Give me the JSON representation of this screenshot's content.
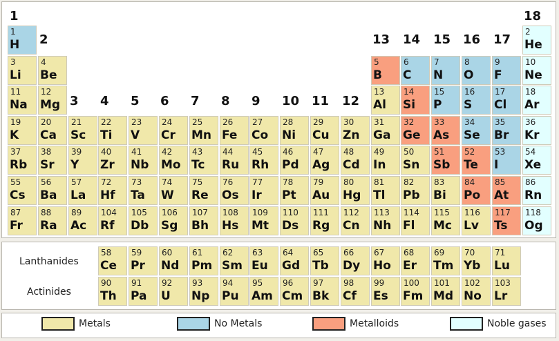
{
  "colors": {
    "metal": "#f0e8aa",
    "nonmetal": "#aad5e6",
    "metalloid": "#f99f7f",
    "noble": "#e2ffff"
  },
  "group_labels": [
    "1",
    "2",
    "3",
    "4",
    "5",
    "6",
    "7",
    "8",
    "9",
    "10",
    "11",
    "12",
    "13",
    "14",
    "15",
    "16",
    "17",
    "18"
  ],
  "row_labels": {
    "lanthanides": "Lanthanides",
    "actinides": "Actinides"
  },
  "legend": [
    {
      "label": "Metals",
      "category": "metal"
    },
    {
      "label": "No Metals",
      "category": "nonmetal"
    },
    {
      "label": "Metalloids",
      "category": "metalloid"
    },
    {
      "label": "Noble gases",
      "category": "noble"
    }
  ],
  "elements": [
    {
      "n": "1",
      "s": "H",
      "period": 1,
      "group": 1,
      "cat": "nonmetal"
    },
    {
      "n": "2",
      "s": "He",
      "period": 1,
      "group": 18,
      "cat": "noble"
    },
    {
      "n": "3",
      "s": "Li",
      "period": 2,
      "group": 1,
      "cat": "metal"
    },
    {
      "n": "4",
      "s": "Be",
      "period": 2,
      "group": 2,
      "cat": "metal"
    },
    {
      "n": "5",
      "s": "B",
      "period": 2,
      "group": 13,
      "cat": "metalloid"
    },
    {
      "n": "6",
      "s": "C",
      "period": 2,
      "group": 14,
      "cat": "nonmetal"
    },
    {
      "n": "7",
      "s": "N",
      "period": 2,
      "group": 15,
      "cat": "nonmetal"
    },
    {
      "n": "8",
      "s": "O",
      "period": 2,
      "group": 16,
      "cat": "nonmetal"
    },
    {
      "n": "9",
      "s": "F",
      "period": 2,
      "group": 17,
      "cat": "nonmetal"
    },
    {
      "n": "10",
      "s": "Ne",
      "period": 2,
      "group": 18,
      "cat": "noble"
    },
    {
      "n": "11",
      "s": "Na",
      "period": 3,
      "group": 1,
      "cat": "metal"
    },
    {
      "n": "12",
      "s": "Mg",
      "period": 3,
      "group": 2,
      "cat": "metal"
    },
    {
      "n": "13",
      "s": "Al",
      "period": 3,
      "group": 13,
      "cat": "metal"
    },
    {
      "n": "14",
      "s": "Si",
      "period": 3,
      "group": 14,
      "cat": "metalloid"
    },
    {
      "n": "15",
      "s": "P",
      "period": 3,
      "group": 15,
      "cat": "nonmetal"
    },
    {
      "n": "16",
      "s": "S",
      "period": 3,
      "group": 16,
      "cat": "nonmetal"
    },
    {
      "n": "17",
      "s": "Cl",
      "period": 3,
      "group": 17,
      "cat": "nonmetal"
    },
    {
      "n": "18",
      "s": "Ar",
      "period": 3,
      "group": 18,
      "cat": "noble"
    },
    {
      "n": "19",
      "s": "K",
      "period": 4,
      "group": 1,
      "cat": "metal"
    },
    {
      "n": "20",
      "s": "Ca",
      "period": 4,
      "group": 2,
      "cat": "metal"
    },
    {
      "n": "21",
      "s": "Sc",
      "period": 4,
      "group": 3,
      "cat": "metal"
    },
    {
      "n": "22",
      "s": "Ti",
      "period": 4,
      "group": 4,
      "cat": "metal"
    },
    {
      "n": "23",
      "s": "V",
      "period": 4,
      "group": 5,
      "cat": "metal"
    },
    {
      "n": "24",
      "s": "Cr",
      "period": 4,
      "group": 6,
      "cat": "metal"
    },
    {
      "n": "25",
      "s": "Mn",
      "period": 4,
      "group": 7,
      "cat": "metal"
    },
    {
      "n": "26",
      "s": "Fe",
      "period": 4,
      "group": 8,
      "cat": "metal"
    },
    {
      "n": "27",
      "s": "Co",
      "period": 4,
      "group": 9,
      "cat": "metal"
    },
    {
      "n": "28",
      "s": "Ni",
      "period": 4,
      "group": 10,
      "cat": "metal"
    },
    {
      "n": "29",
      "s": "Cu",
      "period": 4,
      "group": 11,
      "cat": "metal"
    },
    {
      "n": "30",
      "s": "Zn",
      "period": 4,
      "group": 12,
      "cat": "metal"
    },
    {
      "n": "31",
      "s": "Ga",
      "period": 4,
      "group": 13,
      "cat": "metal"
    },
    {
      "n": "32",
      "s": "Ge",
      "period": 4,
      "group": 14,
      "cat": "metalloid"
    },
    {
      "n": "33",
      "s": "As",
      "period": 4,
      "group": 15,
      "cat": "metalloid"
    },
    {
      "n": "34",
      "s": "Se",
      "period": 4,
      "group": 16,
      "cat": "nonmetal"
    },
    {
      "n": "35",
      "s": "Br",
      "period": 4,
      "group": 17,
      "cat": "nonmetal"
    },
    {
      "n": "36",
      "s": "Kr",
      "period": 4,
      "group": 18,
      "cat": "noble"
    },
    {
      "n": "37",
      "s": "Rb",
      "period": 5,
      "group": 1,
      "cat": "metal"
    },
    {
      "n": "38",
      "s": "Sr",
      "period": 5,
      "group": 2,
      "cat": "metal"
    },
    {
      "n": "39",
      "s": "Y",
      "period": 5,
      "group": 3,
      "cat": "metal"
    },
    {
      "n": "40",
      "s": "Zr",
      "period": 5,
      "group": 4,
      "cat": "metal"
    },
    {
      "n": "41",
      "s": "Nb",
      "period": 5,
      "group": 5,
      "cat": "metal"
    },
    {
      "n": "42",
      "s": "Mo",
      "period": 5,
      "group": 6,
      "cat": "metal"
    },
    {
      "n": "43",
      "s": "Tc",
      "period": 5,
      "group": 7,
      "cat": "metal"
    },
    {
      "n": "44",
      "s": "Ru",
      "period": 5,
      "group": 8,
      "cat": "metal"
    },
    {
      "n": "45",
      "s": "Rh",
      "period": 5,
      "group": 9,
      "cat": "metal"
    },
    {
      "n": "46",
      "s": "Pd",
      "period": 5,
      "group": 10,
      "cat": "metal"
    },
    {
      "n": "47",
      "s": "Ag",
      "period": 5,
      "group": 11,
      "cat": "metal"
    },
    {
      "n": "48",
      "s": "Cd",
      "period": 5,
      "group": 12,
      "cat": "metal"
    },
    {
      "n": "49",
      "s": "In",
      "period": 5,
      "group": 13,
      "cat": "metal"
    },
    {
      "n": "50",
      "s": "Sn",
      "period": 5,
      "group": 14,
      "cat": "metal"
    },
    {
      "n": "51",
      "s": "Sb",
      "period": 5,
      "group": 15,
      "cat": "metalloid"
    },
    {
      "n": "52",
      "s": "Te",
      "period": 5,
      "group": 16,
      "cat": "metalloid"
    },
    {
      "n": "53",
      "s": "I",
      "period": 5,
      "group": 17,
      "cat": "nonmetal"
    },
    {
      "n": "54",
      "s": "Xe",
      "period": 5,
      "group": 18,
      "cat": "noble"
    },
    {
      "n": "55",
      "s": "Cs",
      "period": 6,
      "group": 1,
      "cat": "metal"
    },
    {
      "n": "56",
      "s": "Ba",
      "period": 6,
      "group": 2,
      "cat": "metal"
    },
    {
      "n": "57",
      "s": "La",
      "period": 6,
      "group": 3,
      "cat": "metal"
    },
    {
      "n": "72",
      "s": "Hf",
      "period": 6,
      "group": 4,
      "cat": "metal"
    },
    {
      "n": "73",
      "s": "Ta",
      "period": 6,
      "group": 5,
      "cat": "metal"
    },
    {
      "n": "74",
      "s": "W",
      "period": 6,
      "group": 6,
      "cat": "metal"
    },
    {
      "n": "75",
      "s": "Re",
      "period": 6,
      "group": 7,
      "cat": "metal"
    },
    {
      "n": "76",
      "s": "Os",
      "period": 6,
      "group": 8,
      "cat": "metal"
    },
    {
      "n": "77",
      "s": "Ir",
      "period": 6,
      "group": 9,
      "cat": "metal"
    },
    {
      "n": "78",
      "s": "Pt",
      "period": 6,
      "group": 10,
      "cat": "metal"
    },
    {
      "n": "79",
      "s": "Au",
      "period": 6,
      "group": 11,
      "cat": "metal"
    },
    {
      "n": "80",
      "s": "Hg",
      "period": 6,
      "group": 12,
      "cat": "metal"
    },
    {
      "n": "81",
      "s": "Tl",
      "period": 6,
      "group": 13,
      "cat": "metal"
    },
    {
      "n": "82",
      "s": "Pb",
      "period": 6,
      "group": 14,
      "cat": "metal"
    },
    {
      "n": "83",
      "s": "Bi",
      "period": 6,
      "group": 15,
      "cat": "metal"
    },
    {
      "n": "84",
      "s": "Po",
      "period": 6,
      "group": 16,
      "cat": "metalloid"
    },
    {
      "n": "85",
      "s": "At",
      "period": 6,
      "group": 17,
      "cat": "metalloid"
    },
    {
      "n": "86",
      "s": "Rn",
      "period": 6,
      "group": 18,
      "cat": "noble"
    },
    {
      "n": "87",
      "s": "Fr",
      "period": 7,
      "group": 1,
      "cat": "metal"
    },
    {
      "n": "88",
      "s": "Ra",
      "period": 7,
      "group": 2,
      "cat": "metal"
    },
    {
      "n": "89",
      "s": "Ac",
      "period": 7,
      "group": 3,
      "cat": "metal"
    },
    {
      "n": "104",
      "s": "Rf",
      "period": 7,
      "group": 4,
      "cat": "metal"
    },
    {
      "n": "105",
      "s": "Db",
      "period": 7,
      "group": 5,
      "cat": "metal"
    },
    {
      "n": "106",
      "s": "Sg",
      "period": 7,
      "group": 6,
      "cat": "metal"
    },
    {
      "n": "107",
      "s": "Bh",
      "period": 7,
      "group": 7,
      "cat": "metal"
    },
    {
      "n": "108",
      "s": "Hs",
      "period": 7,
      "group": 8,
      "cat": "metal"
    },
    {
      "n": "109",
      "s": "Mt",
      "period": 7,
      "group": 9,
      "cat": "metal"
    },
    {
      "n": "110",
      "s": "Ds",
      "period": 7,
      "group": 10,
      "cat": "metal"
    },
    {
      "n": "111",
      "s": "Rg",
      "period": 7,
      "group": 11,
      "cat": "metal"
    },
    {
      "n": "112",
      "s": "Cn",
      "period": 7,
      "group": 12,
      "cat": "metal"
    },
    {
      "n": "113",
      "s": "Nh",
      "period": 7,
      "group": 13,
      "cat": "metal"
    },
    {
      "n": "114",
      "s": "Fl",
      "period": 7,
      "group": 14,
      "cat": "metal"
    },
    {
      "n": "115",
      "s": "Mc",
      "period": 7,
      "group": 15,
      "cat": "metal"
    },
    {
      "n": "116",
      "s": "Lv",
      "period": 7,
      "group": 16,
      "cat": "metal"
    },
    {
      "n": "117",
      "s": "Ts",
      "period": 7,
      "group": 17,
      "cat": "metalloid"
    },
    {
      "n": "118",
      "s": "Og",
      "period": 7,
      "group": 18,
      "cat": "noble"
    }
  ],
  "lanthanides": [
    {
      "n": "58",
      "s": "Ce",
      "cat": "metal"
    },
    {
      "n": "59",
      "s": "Pr",
      "cat": "metal"
    },
    {
      "n": "60",
      "s": "Nd",
      "cat": "metal"
    },
    {
      "n": "61",
      "s": "Pm",
      "cat": "metal"
    },
    {
      "n": "62",
      "s": "Sm",
      "cat": "metal"
    },
    {
      "n": "63",
      "s": "Eu",
      "cat": "metal"
    },
    {
      "n": "64",
      "s": "Gd",
      "cat": "metal"
    },
    {
      "n": "65",
      "s": "Tb",
      "cat": "metal"
    },
    {
      "n": "66",
      "s": "Dy",
      "cat": "metal"
    },
    {
      "n": "67",
      "s": "Ho",
      "cat": "metal"
    },
    {
      "n": "68",
      "s": "Er",
      "cat": "metal"
    },
    {
      "n": "69",
      "s": "Tm",
      "cat": "metal"
    },
    {
      "n": "70",
      "s": "Yb",
      "cat": "metal"
    },
    {
      "n": "71",
      "s": "Lu",
      "cat": "metal"
    }
  ],
  "actinides": [
    {
      "n": "90",
      "s": "Th",
      "cat": "metal"
    },
    {
      "n": "91",
      "s": "Pa",
      "cat": "metal"
    },
    {
      "n": "92",
      "s": "U",
      "cat": "metal"
    },
    {
      "n": "93",
      "s": "Np",
      "cat": "metal"
    },
    {
      "n": "94",
      "s": "Pu",
      "cat": "metal"
    },
    {
      "n": "95",
      "s": "Am",
      "cat": "metal"
    },
    {
      "n": "96",
      "s": "Cm",
      "cat": "metal"
    },
    {
      "n": "97",
      "s": "Bk",
      "cat": "metal"
    },
    {
      "n": "98",
      "s": "Cf",
      "cat": "metal"
    },
    {
      "n": "99",
      "s": "Es",
      "cat": "metal"
    },
    {
      "n": "100",
      "s": "Fm",
      "cat": "metal"
    },
    {
      "n": "101",
      "s": "Md",
      "cat": "metal"
    },
    {
      "n": "102",
      "s": "No",
      "cat": "metal"
    },
    {
      "n": "103",
      "s": "Lr",
      "cat": "metal"
    }
  ]
}
